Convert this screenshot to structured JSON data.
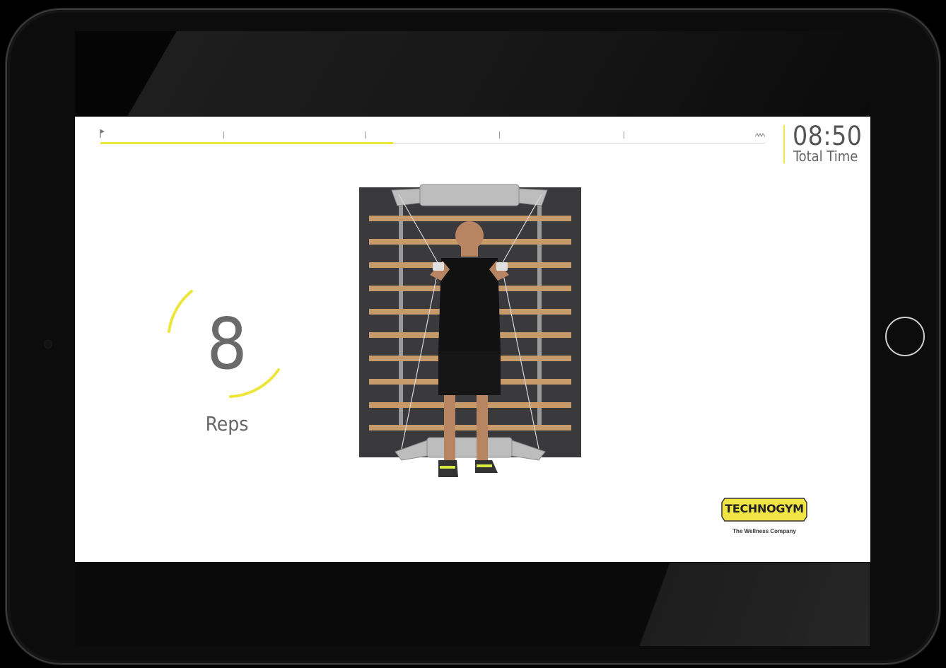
{
  "workout": {
    "total_time_value": "08:50",
    "total_time_label": "Total Time",
    "reps_count": "8",
    "reps_label": "Reps",
    "timeline_progress": 0.44,
    "timeline_tick_fractions": [
      0.185,
      0.398,
      0.6,
      0.787
    ]
  },
  "brand": {
    "logo_text": "TECHNOGYM",
    "tagline": "The Wellness Company"
  },
  "icons": {
    "start": "flag-icon",
    "end": "wave-icon"
  },
  "colors": {
    "accent": "#ece63a",
    "text": "#666666",
    "screen_background": "#ffffff",
    "device_frame": "#0c0c0c"
  }
}
